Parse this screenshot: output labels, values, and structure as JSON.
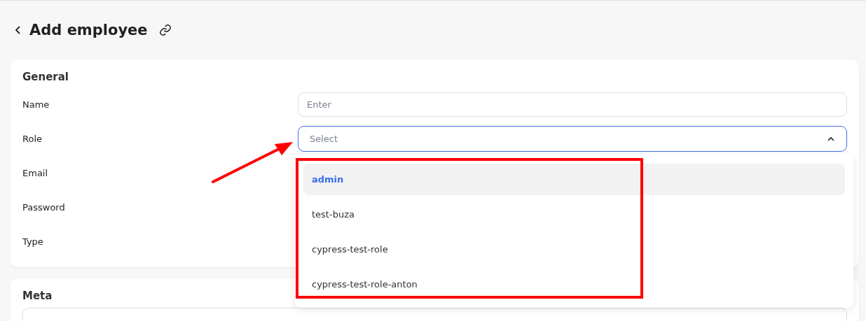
{
  "header": {
    "title": "Add employee"
  },
  "general": {
    "title": "General",
    "fields": [
      {
        "label": "Name",
        "kind": "input",
        "placeholder": "Enter"
      },
      {
        "label": "Role",
        "kind": "select",
        "placeholder": "Select",
        "expanded": true,
        "options": [
          {
            "label": "admin",
            "selected": true
          },
          {
            "label": "test-buza",
            "selected": false
          },
          {
            "label": "cypress-test-role",
            "selected": false
          },
          {
            "label": "cypress-test-role-anton",
            "selected": false
          }
        ]
      },
      {
        "label": "Email",
        "kind": "covered"
      },
      {
        "label": "Password",
        "kind": "covered"
      },
      {
        "label": "Type",
        "kind": "covered"
      }
    ]
  },
  "meta": {
    "title": "Meta"
  }
}
